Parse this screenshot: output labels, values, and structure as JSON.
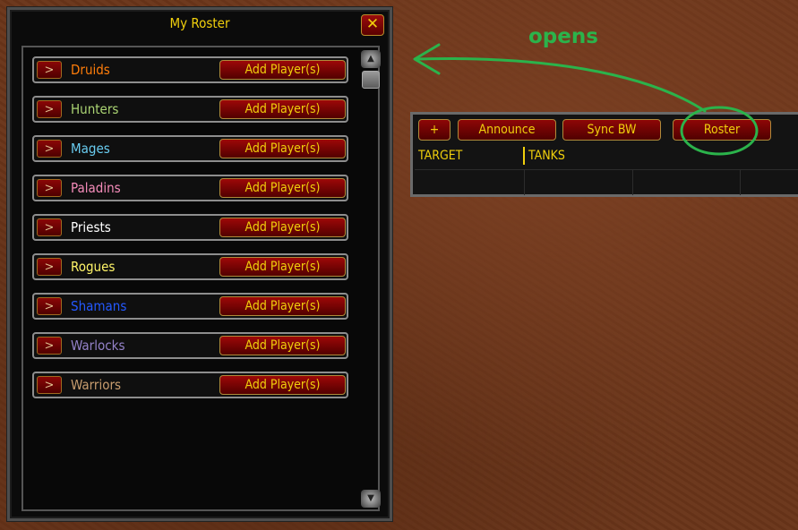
{
  "roster_window": {
    "title": "My Roster",
    "close_glyph": "✕",
    "rows": [
      {
        "expand": ">",
        "label": "Druids",
        "color": "#ff7d0a",
        "button": "Add Player(s)"
      },
      {
        "expand": ">",
        "label": "Hunters",
        "color": "#abd473",
        "button": "Add Player(s)"
      },
      {
        "expand": ">",
        "label": "Mages",
        "color": "#69ccf0",
        "button": "Add Player(s)"
      },
      {
        "expand": ">",
        "label": "Paladins",
        "color": "#f58cba",
        "button": "Add Player(s)"
      },
      {
        "expand": ">",
        "label": "Priests",
        "color": "#ffffff",
        "button": "Add Player(s)"
      },
      {
        "expand": ">",
        "label": "Rogues",
        "color": "#fff569",
        "button": "Add Player(s)"
      },
      {
        "expand": ">",
        "label": "Shamans",
        "color": "#2459ff",
        "button": "Add Player(s)"
      },
      {
        "expand": ">",
        "label": "Warlocks",
        "color": "#9482c9",
        "button": "Add Player(s)"
      },
      {
        "expand": ">",
        "label": "Warriors",
        "color": "#c79c6e",
        "button": "Add Player(s)"
      }
    ]
  },
  "raid_bar": {
    "buttons": {
      "plus": "+",
      "announce": "Announce",
      "sync": "Sync BW",
      "roster": "Roster"
    },
    "columns": {
      "target": "TARGET",
      "tanks": "TANKS"
    }
  },
  "annotation": {
    "text": "opens",
    "color": "#2bb34b"
  }
}
